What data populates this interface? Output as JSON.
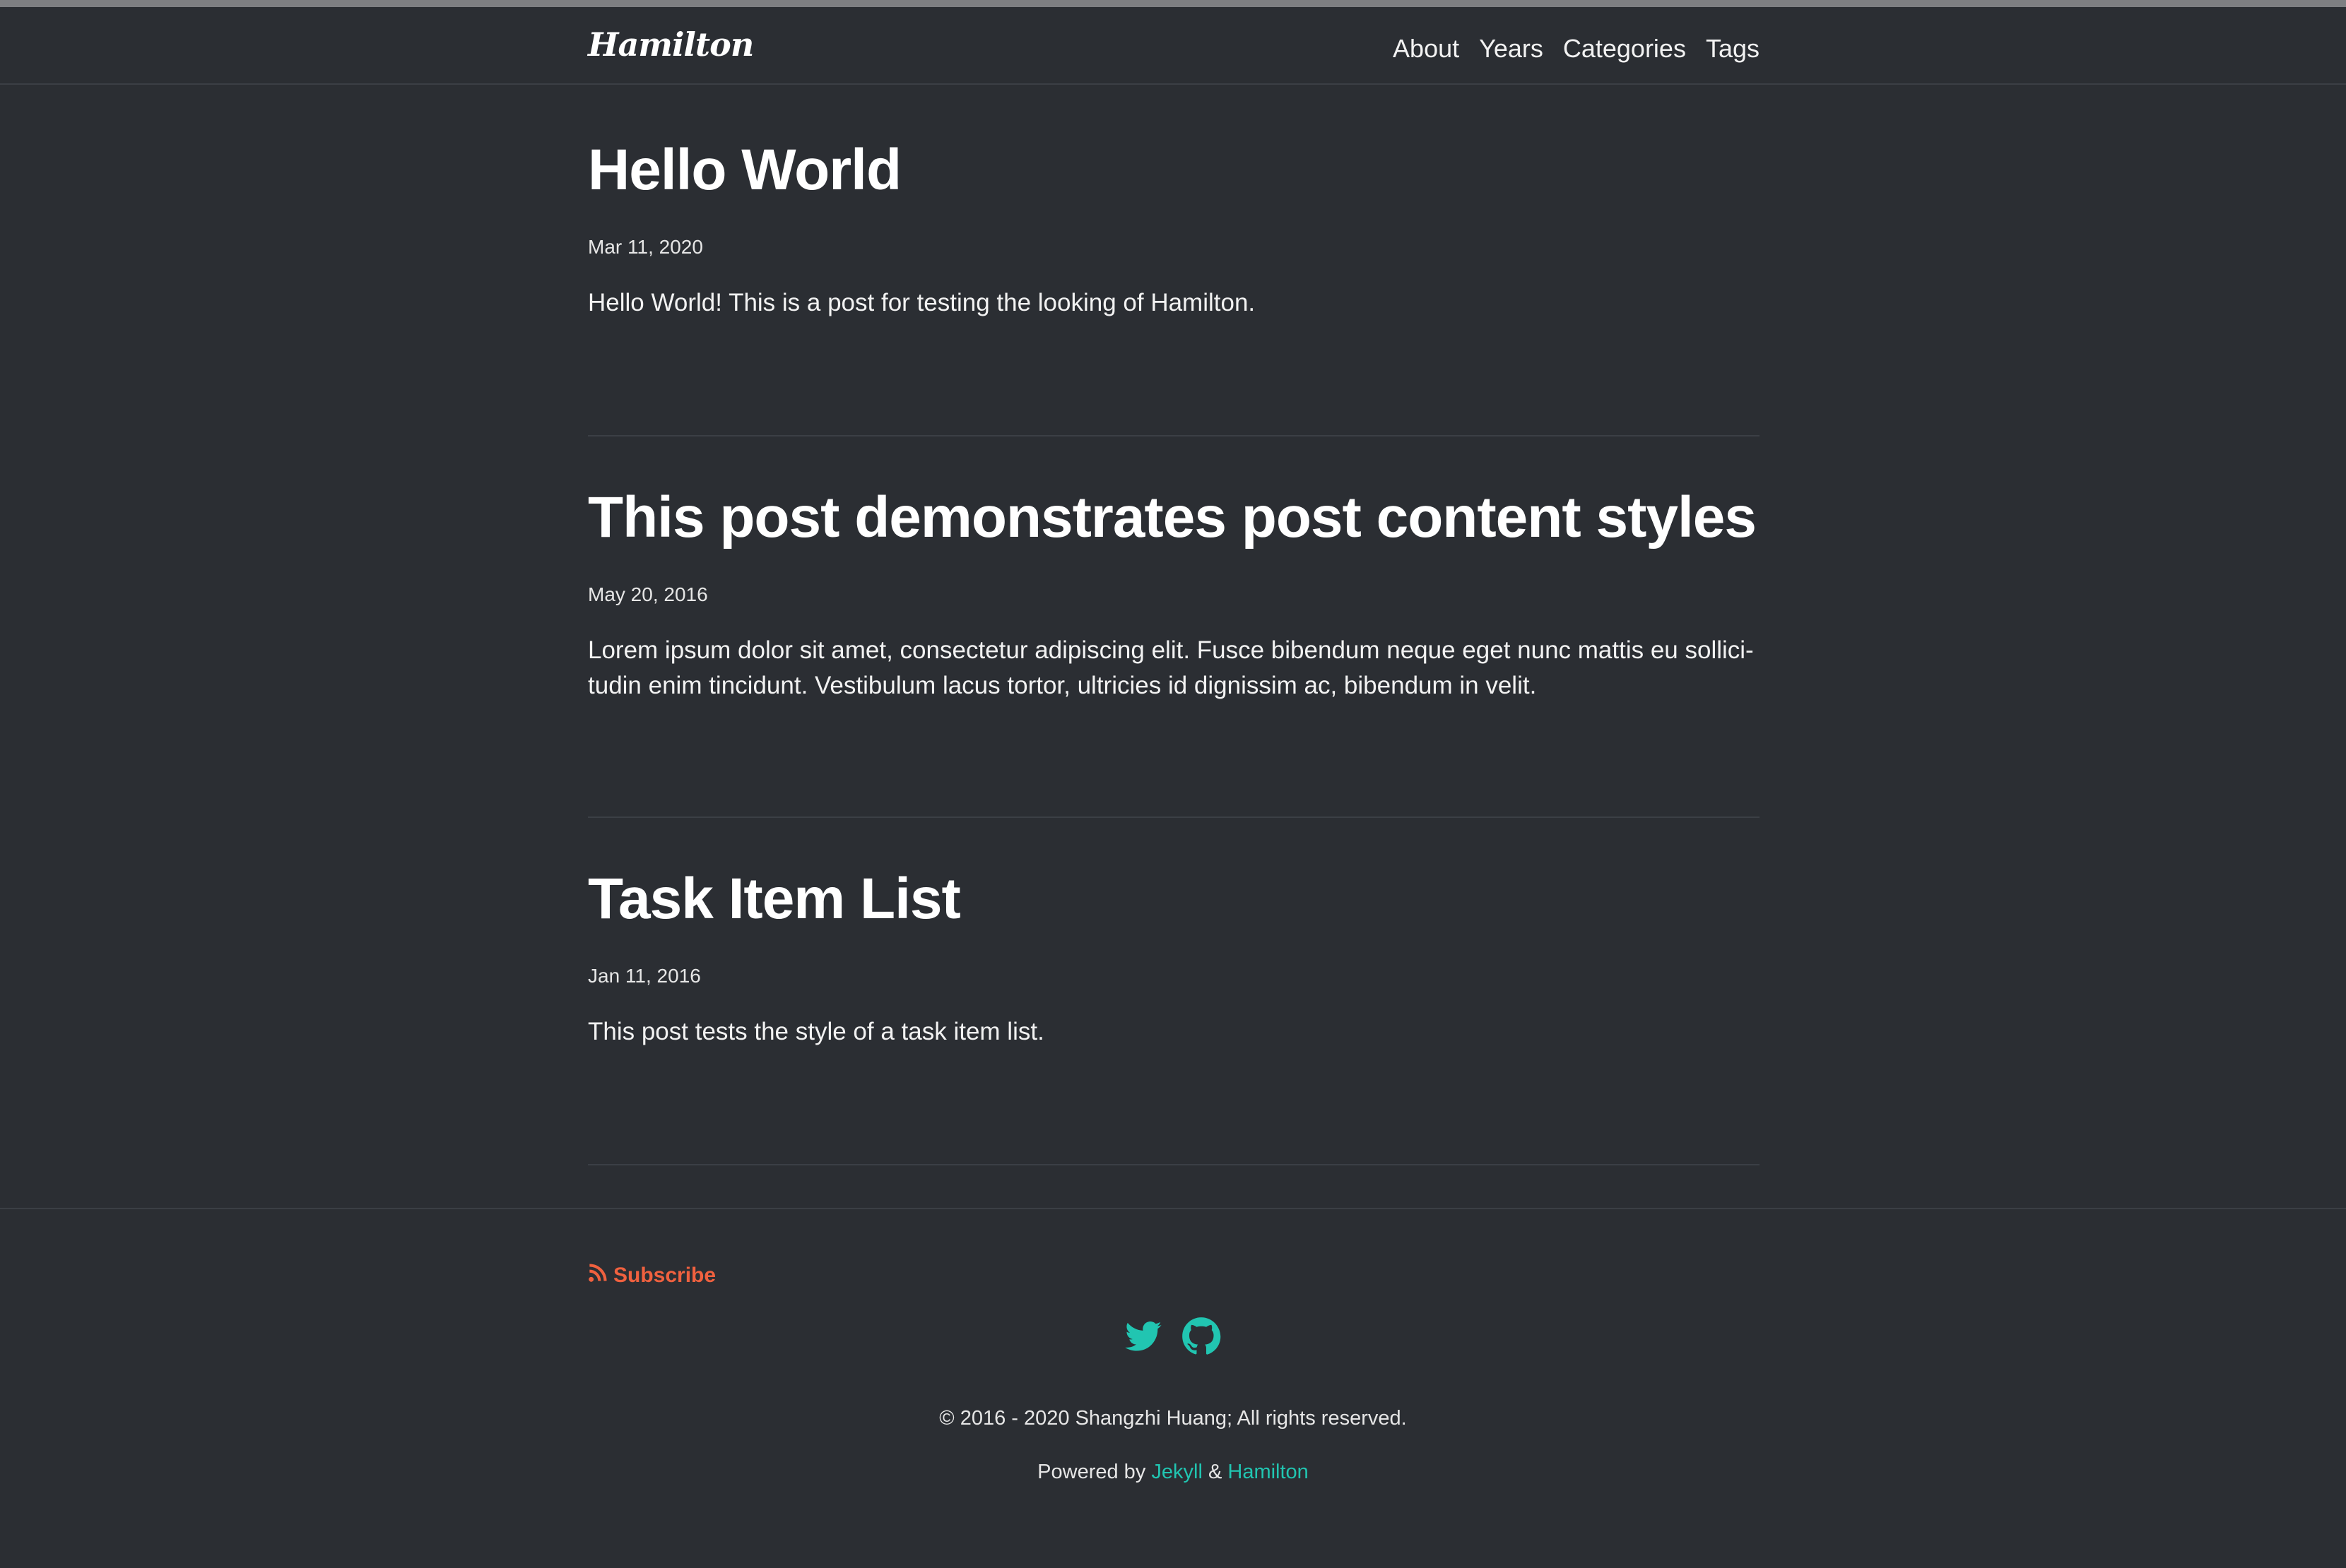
{
  "header": {
    "brand": "Hamilton",
    "nav": [
      "About",
      "Years",
      "Categories",
      "Tags"
    ]
  },
  "posts": [
    {
      "title": "Hello World",
      "date": "Mar 11, 2020",
      "excerpt": "Hello World! This is a post for testing the looking of Hamilton."
    },
    {
      "title": "This post demonstrates post content styles",
      "date": "May 20, 2016",
      "excerpt_line1": "Lorem ipsum dolor sit amet, consectetur adipiscing elit. Fusce bibendum neque eget nunc mattis eu sollici-",
      "excerpt_line2": "tudin enim tincidunt. Vestibulum lacus tortor, ultricies id dignissim ac, bibendum in velit."
    },
    {
      "title": "Task Item List",
      "date": "Jan 11, 2016",
      "excerpt": "This post tests the style of a task item list."
    }
  ],
  "footer": {
    "subscribe_label": "Subscribe",
    "social_icons": [
      "twitter-icon",
      "github-icon"
    ],
    "copyright": "© 2016 - 2020 Shangzhi Huang; All rights reserved.",
    "powered_prefix": "Powered by",
    "powered_jekyll": "Jekyll",
    "powered_and": "&",
    "powered_hamilton": "Hamilton"
  },
  "colors": {
    "background": "#2b2e33",
    "accent_teal": "#21c5b1",
    "subscribe_orange": "#f0613f",
    "text": "#f2f2f2"
  }
}
